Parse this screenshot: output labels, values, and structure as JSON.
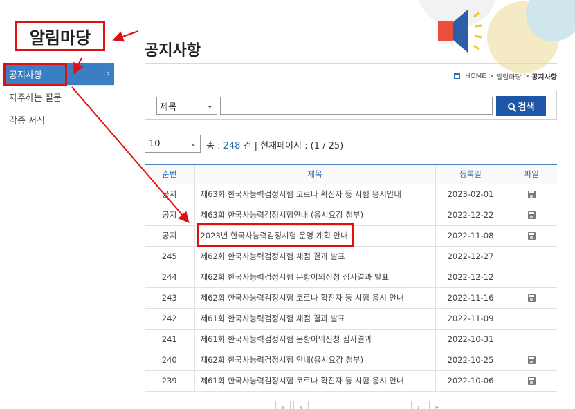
{
  "annotation": {
    "title": "알림마당"
  },
  "sidebar": {
    "items": [
      {
        "label": "공지사항",
        "active": true
      },
      {
        "label": "자주하는 질문",
        "active": false
      },
      {
        "label": "각종 서식",
        "active": false
      }
    ],
    "chevron": "›"
  },
  "page": {
    "title": "공지사항"
  },
  "breadcrumb": {
    "home": "HOME",
    "sep1": ">",
    "section": "알림마당",
    "sep2": ">",
    "current": "공지사항"
  },
  "search": {
    "field_selected": "제목",
    "caret": "⌄",
    "input_value": "",
    "button_label": "검색"
  },
  "listing": {
    "page_size": "10",
    "total_prefix": "총 : ",
    "total_count": "248",
    "total_suffix": " 건 | 현재페이지 : (1 / 25)"
  },
  "table": {
    "headers": {
      "no": "순번",
      "title": "제목",
      "date": "등록일",
      "file": "파일"
    },
    "rows": [
      {
        "no": "공지",
        "title": "제63회 한국사능력검정시험 코로나 확진자 등 시험 응시안내",
        "date": "2023-02-01",
        "file": true
      },
      {
        "no": "공지",
        "title": "제63회 한국사능력검정시험안내 (응시요강 첨부)",
        "date": "2022-12-22",
        "file": true
      },
      {
        "no": "공지",
        "title": "2023년 한국사능력검정시험 운영 계획 안내",
        "date": "2022-11-08",
        "file": true
      },
      {
        "no": "245",
        "title": "제62회 한국사능력검정시험 채점 결과 발표",
        "date": "2022-12-27",
        "file": false
      },
      {
        "no": "244",
        "title": "제62회 한국사능력검정시험 문항이의신청 심사결과 발표",
        "date": "2022-12-12",
        "file": false
      },
      {
        "no": "243",
        "title": "제62회 한국사능력검정시험 코로나 확진자 등 시험 응시 안내",
        "date": "2022-11-16",
        "file": true
      },
      {
        "no": "242",
        "title": "제61회 한국사능력검정시험 채점 결과 발표",
        "date": "2022-11-09",
        "file": false
      },
      {
        "no": "241",
        "title": "제61회 한국사능력검정시험 문항이의신청 심사결과",
        "date": "2022-10-31",
        "file": false
      },
      {
        "no": "240",
        "title": "제62회 한국사능력검정시험 안내(응시요강 첨부)",
        "date": "2022-10-25",
        "file": true
      },
      {
        "no": "239",
        "title": "제61회 한국사능력검정시험 코로나 확진자 등 시험 응시 안내",
        "date": "2022-10-06",
        "file": true
      }
    ]
  },
  "pagination": {
    "first": "«",
    "prev": "‹",
    "next": "›",
    "last": "»"
  },
  "colors": {
    "accent": "#3a7fc4",
    "button": "#1f56a8",
    "annotation": "#e01010"
  }
}
